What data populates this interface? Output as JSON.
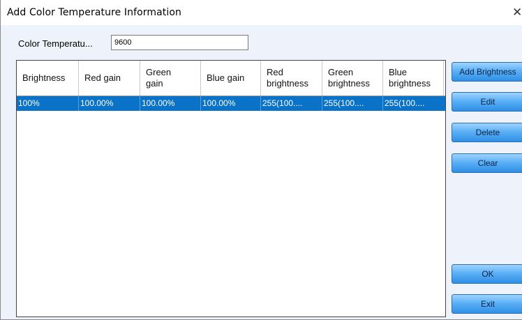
{
  "window": {
    "title": "Add Color Temperature Information",
    "close_glyph": "✕"
  },
  "form": {
    "color_temp_label": "Color Temperatu...",
    "color_temp_value": "9600"
  },
  "table": {
    "columns": [
      "Brightness",
      "Red gain",
      "Green\ngain",
      "Blue gain",
      "Red\nbrightness",
      "Green\nbrightness",
      "Blue\nbrightness"
    ],
    "rows": [
      [
        "100%",
        "100.00%",
        "100.00%",
        "100.00%",
        "255(100....",
        "255(100....",
        "255(100...."
      ]
    ]
  },
  "buttons": {
    "add_brightness": "Add Brightness",
    "edit": "Edit",
    "delete": "Delete",
    "clear": "Clear",
    "ok": "OK",
    "exit": "Exit"
  },
  "colors": {
    "selection": "#0a73c8",
    "button_top": "#9fd3ff",
    "button_bottom": "#2f8fe6",
    "background": "#eef3fb"
  }
}
